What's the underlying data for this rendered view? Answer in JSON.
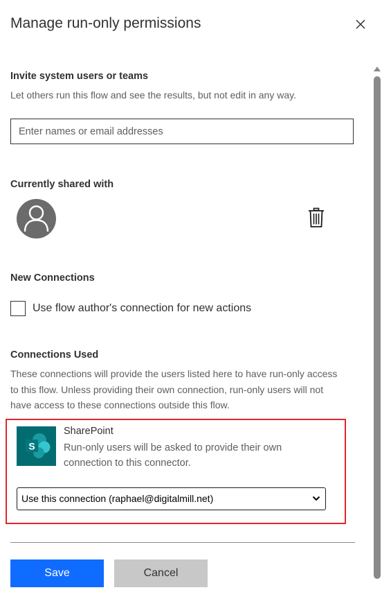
{
  "dialog": {
    "title": "Manage run-only permissions",
    "close_icon": "close-icon"
  },
  "invite": {
    "heading": "Invite system users or teams",
    "description": "Let others run this flow and see the results, but not edit in any way.",
    "placeholder": "Enter names or email addresses",
    "value": ""
  },
  "shared": {
    "heading": "Currently shared with",
    "avatar_icon": "person-icon",
    "remove_icon": "trash-icon"
  },
  "new_connections": {
    "heading": "New Connections",
    "checkbox_label": "Use flow author's connection for new actions",
    "checked": false
  },
  "connections_used": {
    "heading": "Connections Used",
    "description_lines": [
      "These connections will provide the users listed here to have run-only access",
      "to this flow. Unless providing their own connection, run-only users will not",
      "have access to these connections outside this flow."
    ],
    "connector": {
      "name": "SharePoint",
      "logo_icon": "sharepoint-logo",
      "logo_letter": "S",
      "description_lines": [
        "Run-only users will be asked to provide their own",
        "connection to this connector."
      ],
      "selected_option": "Use this connection (raphael@digitalmill.net)"
    }
  },
  "footer": {
    "save_label": "Save",
    "cancel_label": "Cancel"
  },
  "colors": {
    "primary": "#0f6cff",
    "highlight_border": "#e0262b",
    "sharepoint": "#036c70"
  }
}
